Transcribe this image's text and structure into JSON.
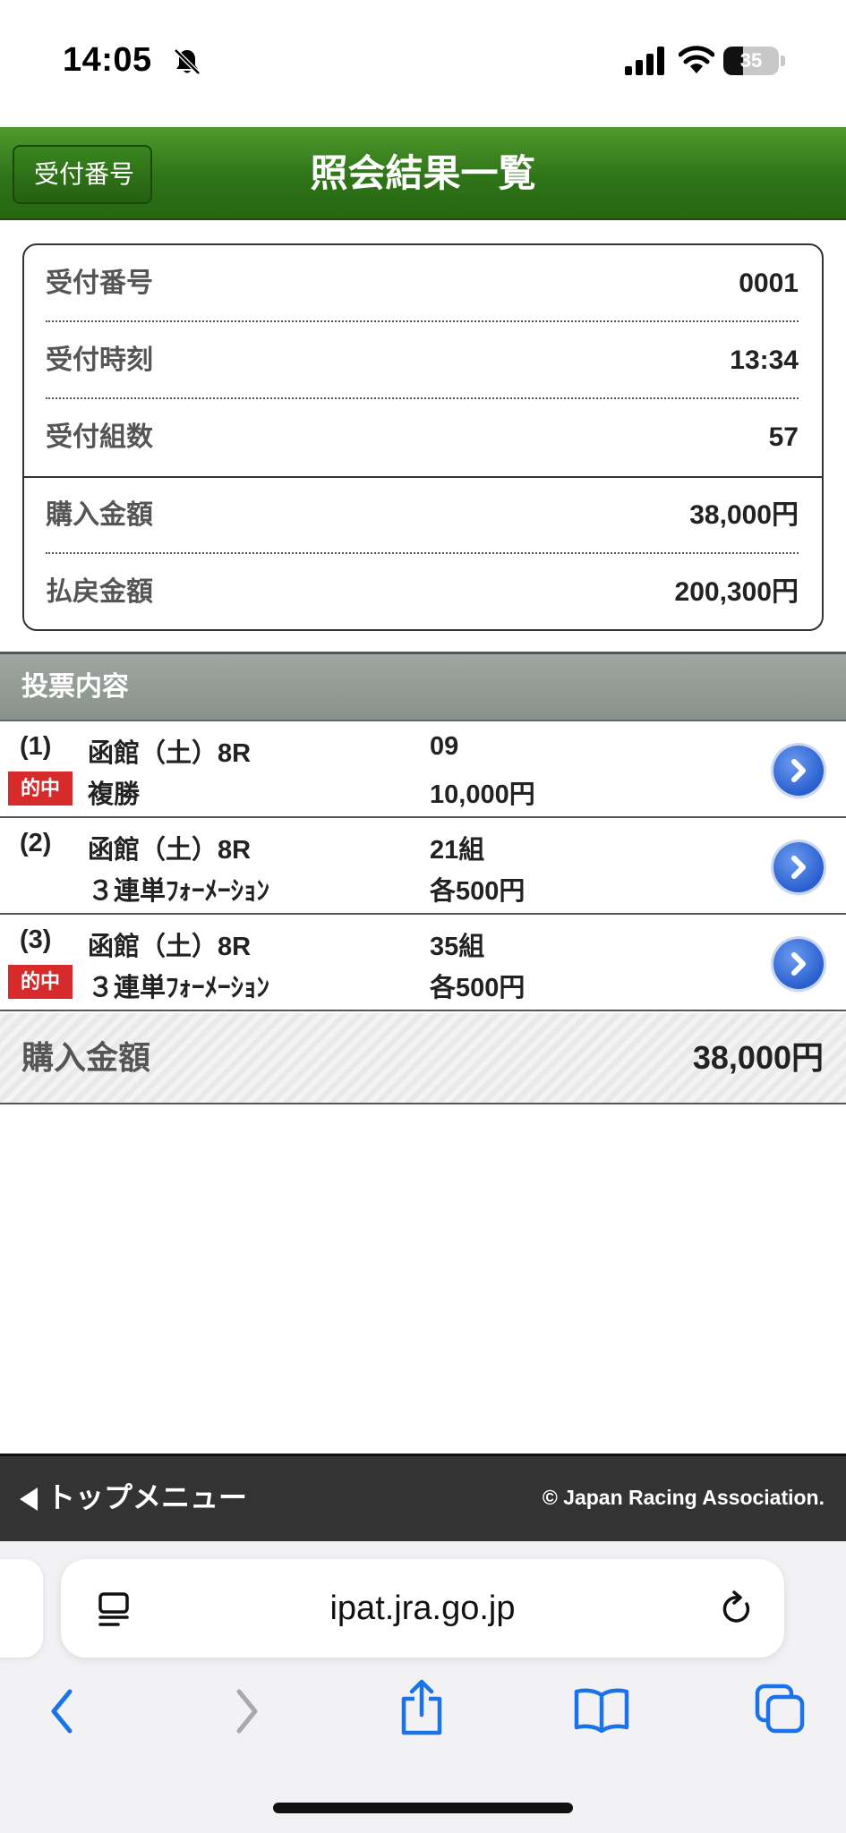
{
  "status_bar": {
    "time": "14:05",
    "battery": "35",
    "battery_level": 0.35
  },
  "header": {
    "back_label": "受付番号",
    "title": "照会結果一覧"
  },
  "summary": {
    "rows": [
      {
        "label": "受付番号",
        "value": "0001"
      },
      {
        "label": "受付時刻",
        "value": "13:34"
      },
      {
        "label": "受付組数",
        "value": "57"
      },
      {
        "label": "購入金額",
        "value": "38,000円"
      },
      {
        "label": "払戻金額",
        "value": "200,300円"
      }
    ]
  },
  "bets": {
    "section_title": "投票内容",
    "hit_label": "的中",
    "items": [
      {
        "index": "(1)",
        "race": "函館（土）8R",
        "type": "複勝",
        "selection": "09",
        "amount": "10,000円",
        "hit": true
      },
      {
        "index": "(2)",
        "race": "函館（土）8R",
        "type": "３連単ﾌｫｰﾒｰｼｮﾝ",
        "selection": "21組",
        "amount": "各500円",
        "hit": false
      },
      {
        "index": "(3)",
        "race": "函館（土）8R",
        "type": "３連単ﾌｫｰﾒｰｼｮﾝ",
        "selection": "35組",
        "amount": "各500円",
        "hit": true
      }
    ]
  },
  "total": {
    "label": "購入金額",
    "value": "38,000円"
  },
  "footer": {
    "menu_label": "トップメニュー",
    "copyright": "© Japan Racing Association."
  },
  "browser": {
    "url": "ipat.jra.go.jp"
  },
  "icons": {
    "status": [
      "bell-slash-icon",
      "signal-icon",
      "wifi-icon",
      "battery-icon"
    ],
    "toolbar": [
      "chevron-left-icon",
      "chevron-right-icon",
      "share-icon",
      "bookmarks-icon",
      "tabs-icon"
    ],
    "row_action": "chevron-right-circle-icon"
  },
  "colors": {
    "header_green": "#2f7418",
    "hit_red": "#d72a2a",
    "link_blue": "#2a5fcf",
    "ios_blue": "#1a73e8"
  }
}
